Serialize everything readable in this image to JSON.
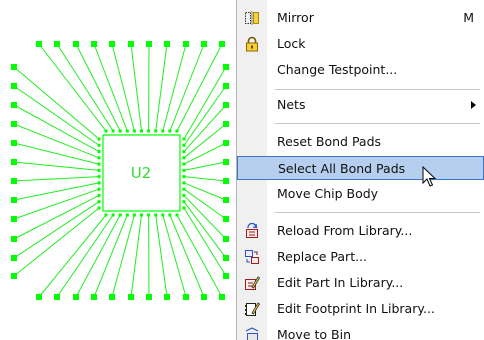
{
  "pcb": {
    "component_label": "U2",
    "trace_color": "#22ee22",
    "pad_color": "#00ff00",
    "label_color": "#33dd33"
  },
  "menu": {
    "items": [
      {
        "label": "Mirror",
        "shortcut": "M",
        "icon": "mirror-icon"
      },
      {
        "label": "Lock",
        "icon": "lock-icon"
      },
      {
        "label": "Change Testpoint..."
      },
      {
        "label": "Nets",
        "submenu": true
      },
      {
        "label": "Reset Bond Pads"
      },
      {
        "label": "Select All Bond Pads",
        "highlighted": true
      },
      {
        "label": "Move Chip Body"
      },
      {
        "label": "Reload From Library...",
        "icon": "reload-library-icon"
      },
      {
        "label": "Replace Part...",
        "icon": "replace-part-icon"
      },
      {
        "label": "Edit Part In Library...",
        "icon": "edit-part-icon"
      },
      {
        "label": "Edit Footprint In Library...",
        "icon": "edit-footprint-icon"
      },
      {
        "label": "Move to Bin",
        "icon": "move-to-bin-icon"
      }
    ],
    "highlight_color": "#b6cfee"
  }
}
